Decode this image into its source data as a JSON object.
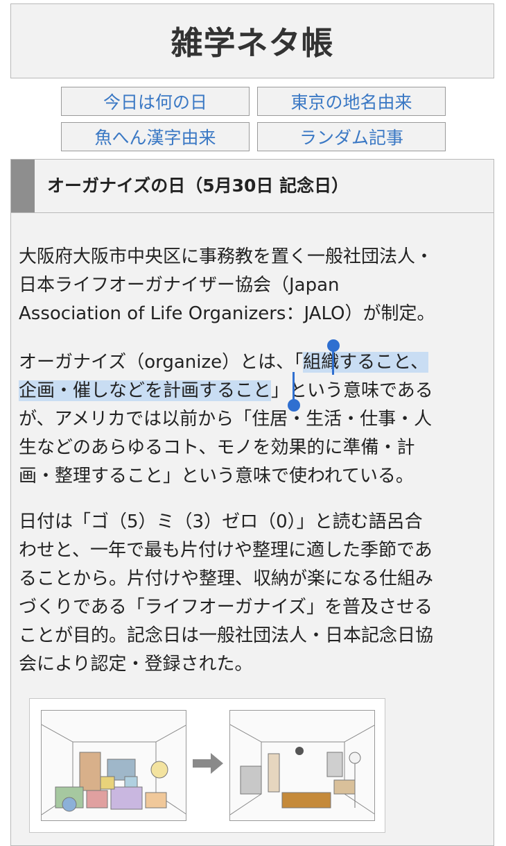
{
  "header": {
    "title": "雑学ネタ帳"
  },
  "nav": {
    "items": [
      {
        "label": "今日は何の日"
      },
      {
        "label": "東京の地名由来"
      },
      {
        "label": "魚へん漢字由来"
      },
      {
        "label": "ランダム記事"
      }
    ]
  },
  "article": {
    "title": "オーガナイズの日（5月30日 記念日）",
    "p1": {
      "line1": "大阪府大阪市中央区に事務教を置く一般社団法人・",
      "line2": "日本ライフオーガナイザー協会（Japan",
      "line3": "Association of Life Organizers：JALO）が制定。"
    },
    "p2": {
      "before": "オーガナイズ（organize）とは、「",
      "selected_line1": "組織すること、",
      "selected_line2": "企画・催しなどを計画すること",
      "after_line2": "」という意味である",
      "line3": "が、アメリカでは以前から「住居・生活・仕事・人",
      "line4": "生などのあらゆるコト、モノを効果的に準備・計",
      "line5": "画・整理すること」という意味で使われている。"
    },
    "p3": {
      "line1": "日付は「ゴ（5）ミ（3）ゼロ（0）」と読む語呂合",
      "line2": "わせと、一年で最も片付けや整理に適した季節であ",
      "line3": "ることから。片付けや整理、収納が楽になる仕組み",
      "line4": "づくりである「ライフオーガナイズ」を普及させる",
      "line5": "ことが目的。記念日は一般社団法人・日本記念日協",
      "line6": "会により認定・登録された。"
    }
  },
  "colors": {
    "link": "#3a78c4",
    "selection": "#c9ddf3",
    "handle": "#2f6fd0"
  }
}
